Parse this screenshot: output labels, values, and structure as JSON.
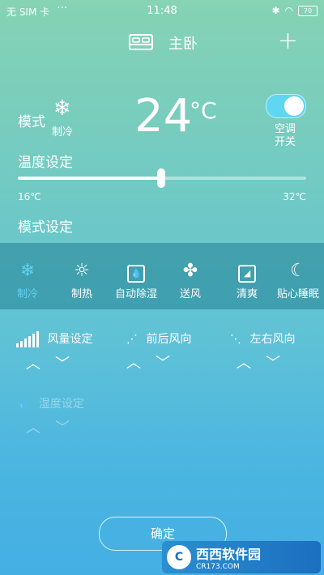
{
  "status_bar": {
    "carrier": "无 SIM 卡",
    "time": "11:48",
    "battery": "70"
  },
  "header": {
    "title": "主卧",
    "bed_icon": "bed-icon",
    "add_icon": "plus-icon"
  },
  "mode": {
    "label": "模式",
    "current": "制冷",
    "icon": "snowflake-icon"
  },
  "temperature": {
    "value": "24",
    "unit": "°C"
  },
  "power_toggle": {
    "label_line1": "空调",
    "label_line2": "开关",
    "on": true,
    "accent": "#5fd7f0"
  },
  "temp_setting": {
    "label": "温度设定",
    "min": "16℃",
    "max": "32℃",
    "level": 0.5
  },
  "mode_setting": {
    "label": "模式设定"
  },
  "modes": [
    {
      "label": "制冷",
      "icon": "snowflake-icon",
      "active": true
    },
    {
      "label": "制热",
      "icon": "sun-icon",
      "active": false
    },
    {
      "label": "自动除湿",
      "icon": "droplet-icon",
      "active": false
    },
    {
      "label": "送风",
      "icon": "fan-icon",
      "active": false
    },
    {
      "label": "清爽",
      "icon": "fresh-icon",
      "active": false
    },
    {
      "label": "贴心睡眠",
      "icon": "moon-icon",
      "active": false
    }
  ],
  "controls": {
    "fan_speed": {
      "label": "风量设定"
    },
    "vertical_swing": {
      "label": "前后风向"
    },
    "horizontal_swing": {
      "label": "左右风向"
    },
    "humidity": {
      "label": "湿度设定"
    }
  },
  "confirm": {
    "label": "确定"
  },
  "watermark": {
    "text": "西西软件园",
    "sub": "CR173.COM"
  }
}
